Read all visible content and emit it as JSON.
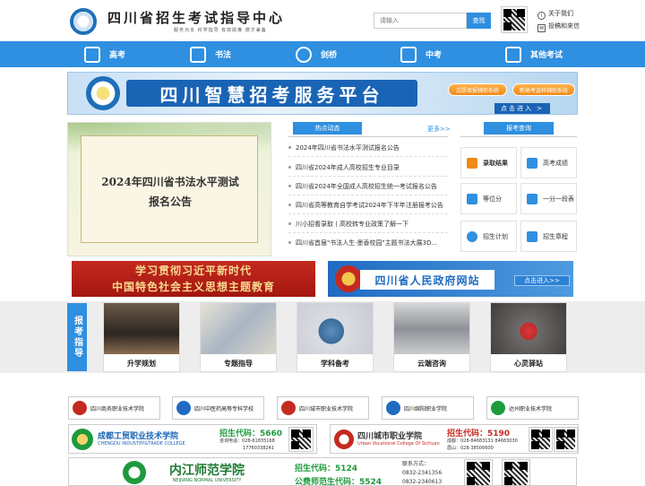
{
  "header": {
    "site_title": "四川省招生考试指导中心",
    "slogan": "服务为本 科学指导 有效助推 德才兼备",
    "search_placeholder": "请输入",
    "search_button": "查找",
    "links": [
      {
        "label": "关于我们",
        "icon": "info-icon"
      },
      {
        "label": "投稿和来信",
        "icon": "mail-icon"
      }
    ]
  },
  "nav": {
    "items": [
      {
        "label": "高考",
        "icon": "monitor-icon"
      },
      {
        "label": "书法",
        "icon": "chart-icon"
      },
      {
        "label": "剑桥",
        "icon": "grid-icon"
      },
      {
        "label": "中考",
        "icon": "bar-chart-icon"
      },
      {
        "label": "其他考试",
        "icon": "document-icon"
      }
    ]
  },
  "banner": {
    "title": "四川智慧招考服务平台",
    "button_1": "志愿填报辅助系统",
    "button_2": "新高考选科辅助系统",
    "enter": "点击进入 >"
  },
  "feature": {
    "title_line_1": "2024年四川省书法水平测试",
    "title_line_2": "报名公告"
  },
  "news": {
    "heading": "热点动态",
    "more": "更多>>",
    "items": [
      "2024年四川省书法水平测试报名公告",
      "四川省2024年成人高校招生专业目录",
      "四川省2024年全国成人高校招生统一考试报名公告",
      "四川省高等教育自学考试2024年下半年注册报考公告",
      "川小招看录取丨高校转专业政策了解一下",
      "四川省首届\"书法人生·墨香校园\"主题书法大展3D..."
    ]
  },
  "query": {
    "heading": "报考查询",
    "items": [
      {
        "label": "录取结果",
        "bold": true
      },
      {
        "label": "高考成绩",
        "bold": false
      },
      {
        "label": "等位分",
        "bold": false
      },
      {
        "label": "一分一段表",
        "bold": false
      },
      {
        "label": "招生计划",
        "bold": false
      },
      {
        "label": "招生章程",
        "bold": false
      }
    ]
  },
  "ads": {
    "left_line_1": "学习贯彻习近平新时代",
    "left_line_2": "中国特色社会主义思想主题教育",
    "right_title": "四川省人民政府网站",
    "right_enter": "点击进入>>"
  },
  "guide": {
    "label": "报考指导",
    "cards": [
      "升学规划",
      "专题指导",
      "学科备考",
      "云端咨询",
      "心灵驿站"
    ]
  },
  "schools": {
    "row1": [
      "四川商务职业技术学院",
      "四川中医药高等专科学校",
      "四川城市职业技术学院",
      "四川绵阳职业学院",
      "达州职业技术学院"
    ],
    "chengdu": {
      "name": "成都工贸职业技术学院",
      "name_en": "CHENGDU INDUSTRY&TRADE COLLEGE",
      "code_label": "招生代码：5660",
      "phone": "咨询电话：028-61835168",
      "phone2": "17760338241"
    },
    "urban": {
      "name": "四川城市职业学院",
      "name_en": "Urban Vocational College Of Sichuan",
      "code_label": "招生代码：5190",
      "phone": "成都：028-84683131 84683030",
      "phone2": "眉山：028-38500600"
    },
    "neijiang": {
      "name": "内江师范学院",
      "name_en": "NEIJIANG NORMAL UNIVERSITY",
      "code_label": "招生代码：5124",
      "code_label_2": "公费师范生代码：5524",
      "contact_label": "联系方式：",
      "phone": "0832-2341356",
      "phone2": "0832-2340613"
    }
  }
}
